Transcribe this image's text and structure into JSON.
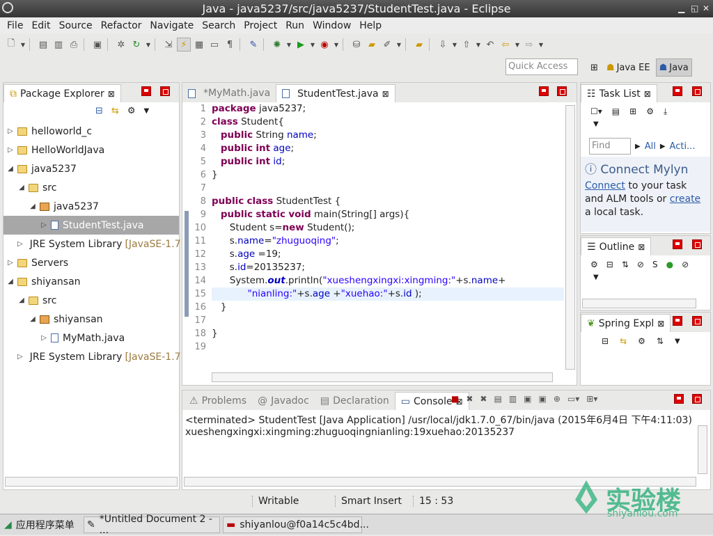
{
  "window": {
    "title": "Java - java5237/src/java5237/StudentTest.java - Eclipse"
  },
  "menu": [
    "File",
    "Edit",
    "Source",
    "Refactor",
    "Navigate",
    "Search",
    "Project",
    "Run",
    "Window",
    "Help"
  ],
  "quick_access": {
    "placeholder": "Quick Access"
  },
  "perspectives": [
    {
      "label": "Java EE"
    },
    {
      "label": "Java"
    }
  ],
  "package_explorer": {
    "title": "Package Explorer",
    "tree": [
      {
        "label": "helloworld_c",
        "level": 0,
        "icon": "folder-icon",
        "expanded": false
      },
      {
        "label": "HelloWorldJava",
        "level": 0,
        "icon": "folder-icon",
        "expanded": false
      },
      {
        "label": "java5237",
        "level": 0,
        "icon": "folder-icon",
        "expanded": true
      },
      {
        "label": "src",
        "level": 1,
        "icon": "folder-icon",
        "expanded": true
      },
      {
        "label": "java5237",
        "level": 2,
        "icon": "package-icon",
        "expanded": true
      },
      {
        "label": "StudentTest.java",
        "level": 3,
        "icon": "java-file-icon",
        "expanded": false,
        "selected": true
      },
      {
        "label": "JRE System Library",
        "suffix": "[JavaSE-1.7]",
        "level": 1,
        "icon": "library-icon",
        "expanded": false
      },
      {
        "label": "Servers",
        "level": 0,
        "icon": "folder-icon",
        "expanded": false
      },
      {
        "label": "shiyansan",
        "level": 0,
        "icon": "folder-icon",
        "expanded": true
      },
      {
        "label": "src",
        "level": 1,
        "icon": "folder-icon",
        "expanded": true
      },
      {
        "label": "shiyansan",
        "level": 2,
        "icon": "package-icon",
        "expanded": true
      },
      {
        "label": "MyMath.java",
        "level": 3,
        "icon": "java-file-icon",
        "expanded": false
      },
      {
        "label": "JRE System Library",
        "suffix": "[JavaSE-1.7]",
        "level": 1,
        "icon": "library-icon",
        "expanded": false
      }
    ]
  },
  "editor": {
    "tabs": [
      {
        "label": "*MyMath.java"
      },
      {
        "label": "StudentTest.java"
      }
    ],
    "lines": [
      [
        [
          "kw",
          "package"
        ],
        [
          "t",
          " java5237;"
        ]
      ],
      [
        [
          "kw",
          "class"
        ],
        [
          "t",
          " Student{"
        ]
      ],
      [
        [
          "t",
          "   "
        ],
        [
          "kw",
          "public"
        ],
        [
          "t",
          " String "
        ],
        [
          "fld",
          "name"
        ],
        [
          "t",
          ";"
        ]
      ],
      [
        [
          "t",
          "   "
        ],
        [
          "kw",
          "public"
        ],
        [
          "t",
          " "
        ],
        [
          "kw",
          "int"
        ],
        [
          "t",
          " "
        ],
        [
          "fld",
          "age"
        ],
        [
          "t",
          ";"
        ]
      ],
      [
        [
          "t",
          "   "
        ],
        [
          "kw",
          "public"
        ],
        [
          "t",
          " "
        ],
        [
          "kw",
          "int"
        ],
        [
          "t",
          " "
        ],
        [
          "fld",
          "id"
        ],
        [
          "t",
          ";"
        ]
      ],
      [
        [
          "t",
          "}"
        ]
      ],
      [
        [
          "t",
          ""
        ]
      ],
      [
        [
          "kw",
          "public"
        ],
        [
          "t",
          " "
        ],
        [
          "kw",
          "class"
        ],
        [
          "t",
          " StudentTest {"
        ]
      ],
      [
        [
          "t",
          "   "
        ],
        [
          "kw",
          "public"
        ],
        [
          "t",
          " "
        ],
        [
          "kw",
          "static"
        ],
        [
          "t",
          " "
        ],
        [
          "kw",
          "void"
        ],
        [
          "t",
          " main(String[] args){"
        ]
      ],
      [
        [
          "t",
          "      Student s="
        ],
        [
          "kw",
          "new"
        ],
        [
          "t",
          " Student();"
        ]
      ],
      [
        [
          "t",
          "      s."
        ],
        [
          "fld",
          "name"
        ],
        [
          "t",
          "="
        ],
        [
          "str",
          "\"zhuguoqing\""
        ],
        [
          "t",
          ";"
        ]
      ],
      [
        [
          "t",
          "      s."
        ],
        [
          "fld",
          "age"
        ],
        [
          "t",
          " =19;"
        ]
      ],
      [
        [
          "t",
          "      s."
        ],
        [
          "fld",
          "id"
        ],
        [
          "t",
          "=20135237;"
        ]
      ],
      [
        [
          "t",
          "      System."
        ],
        [
          "fld",
          "out"
        ],
        [
          "t",
          ".println("
        ],
        [
          "str",
          "\"xueshengxingxi:xingming:\""
        ],
        [
          "t",
          "+s."
        ],
        [
          "fld",
          "name"
        ],
        [
          "t",
          "+"
        ]
      ],
      [
        [
          "t",
          "            "
        ],
        [
          "str",
          "\"nianling:\""
        ],
        [
          "t",
          "+s."
        ],
        [
          "fld",
          "age"
        ],
        [
          "t",
          " +"
        ],
        [
          "str",
          "\"xuehao:\""
        ],
        [
          "t",
          "+s."
        ],
        [
          "fld",
          "id"
        ],
        [
          "t",
          " );"
        ]
      ],
      [
        [
          "t",
          "   }"
        ]
      ],
      [
        [
          "t",
          ""
        ]
      ],
      [
        [
          "t",
          "}"
        ]
      ],
      [
        [
          "t",
          ""
        ]
      ]
    ]
  },
  "task_list": {
    "title": "Task List",
    "find_placeholder": "Find",
    "all_label": "All",
    "acti_label": "Acti..."
  },
  "mylyn": {
    "title": "Connect Mylyn",
    "text_pre": "",
    "connect_link": "Connect",
    "text_mid": " to your task and ALM tools or ",
    "create_link": "create",
    "text_post": " a local task."
  },
  "outline": {
    "title": "Outline"
  },
  "spring": {
    "title": "Spring Expl"
  },
  "console": {
    "tabs": [
      {
        "label": "Problems"
      },
      {
        "label": "Javadoc"
      },
      {
        "label": "Declaration"
      },
      {
        "label": "Console"
      }
    ],
    "header": "<terminated> StudentTest [Java Application] /usr/local/jdk1.7.0_67/bin/java (2015年6月4日 下午4:11:03)",
    "output": "xueshengxingxi:xingming:zhuguoqingnianling:19xuehao:20135237"
  },
  "status": {
    "writable": "Writable",
    "insert": "Smart Insert",
    "position": "15 : 53"
  },
  "taskbar": {
    "apps_menu": "应用程序菜单",
    "item1": "*Untitled Document 2 - ...",
    "item2": "shiyanlou@f0a14c5c4bd..."
  },
  "watermark": {
    "brand": "实验楼",
    "url": "shiyanlou.com"
  }
}
